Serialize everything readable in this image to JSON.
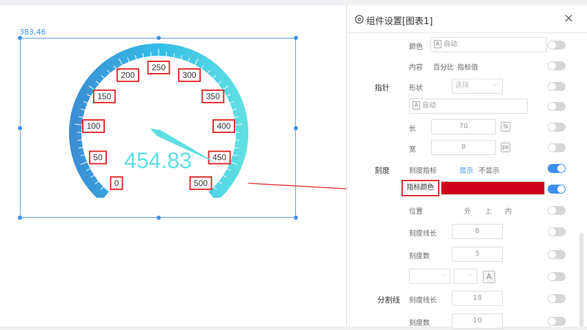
{
  "canvas": {
    "coord_label": "383,46",
    "gauge": {
      "value_text": "454.83",
      "tick_labels": [
        "0",
        "50",
        "100",
        "150",
        "200",
        "250",
        "300",
        "350",
        "400",
        "450",
        "500"
      ],
      "min": 0,
      "max": 500,
      "pointer_value": 460,
      "colors": {
        "arc_start": "#3b8fd6",
        "arc_mid": "#34bde6",
        "arc_end": "#5fdfe3",
        "value_text": "#5fdfe3",
        "label_box": "#e02d2d"
      }
    }
  },
  "panel": {
    "title": "组件设置[图表1]",
    "close_symbol": "×",
    "rows": {
      "color_label": "颜色",
      "color_value": "自动",
      "content_label": "内容",
      "content_opt1": "百分比",
      "content_opt2": "指标值",
      "pointer_section": "指针",
      "shape_label": "形状",
      "shape_value": "选择",
      "pointer_color_value": "自动",
      "length_label": "长",
      "length_value": "70",
      "length_unit": "%",
      "width_label": "宽",
      "width_value": "8",
      "width_unit": "px",
      "scale_section": "刻度",
      "scale_indicator_label": "刻度指标",
      "show": "显示",
      "hide": "不显示",
      "indicator_color_label": "指标颜色",
      "indicator_color": "#d0021b",
      "position_label": "位置",
      "pos_outer": "外",
      "pos_top": "上",
      "pos_inner": "内",
      "tick_length_label": "刻度线长",
      "tick_length_value": "8",
      "tick_count_label": "刻度数",
      "tick_count_value": "5",
      "font_icon": "A",
      "divider_section": "分割线",
      "div_tick_length_label": "刻度线长",
      "div_tick_length_value": "18",
      "div_tick_count_label": "刻度数",
      "div_tick_count_value": "10"
    },
    "toggles": [
      false,
      false,
      false,
      false,
      false,
      false,
      true,
      true,
      false,
      false,
      false,
      false,
      false,
      false
    ]
  }
}
